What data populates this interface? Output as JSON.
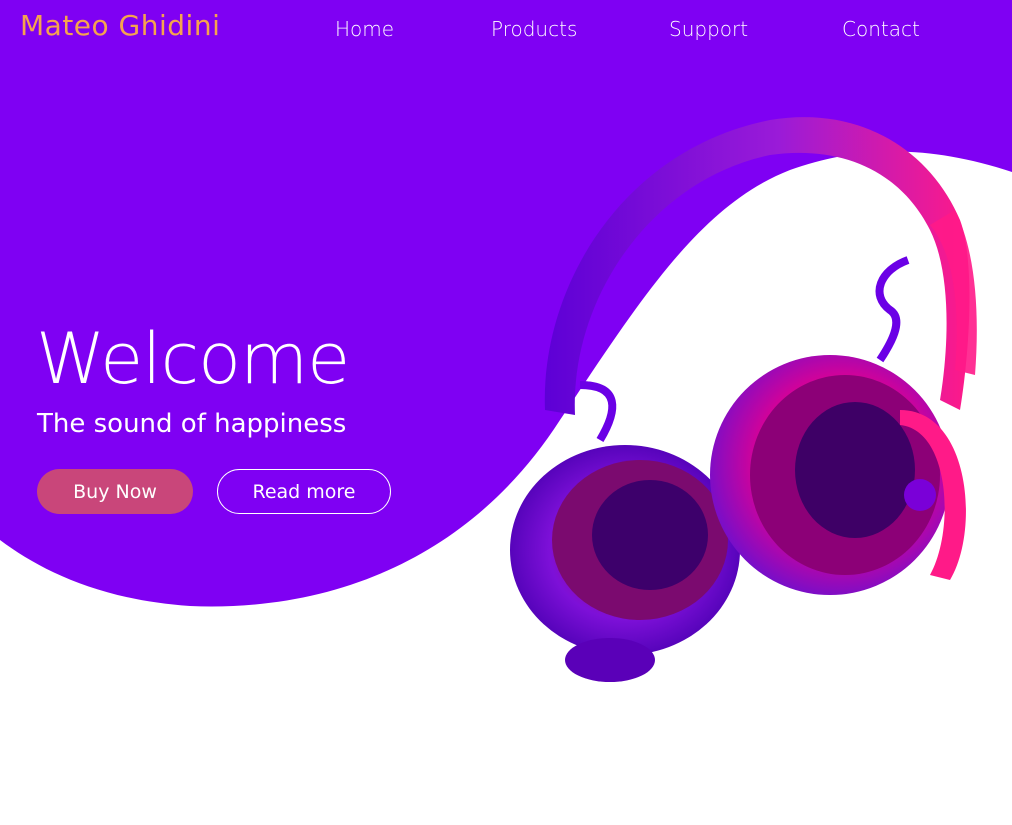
{
  "brand": {
    "name": "Mateo Ghidini"
  },
  "nav": {
    "items": [
      "Home",
      "Products",
      "Support",
      "Contact"
    ]
  },
  "hero": {
    "title": "Welcome",
    "subtitle": "The sound of happiness",
    "primary_button": "Buy Now",
    "secondary_button": "Read more"
  },
  "colors": {
    "purple": "#7f00f3",
    "brand_orange": "#f6a34d",
    "button_pink": "#c9467a",
    "magenta": "#e6007a"
  }
}
